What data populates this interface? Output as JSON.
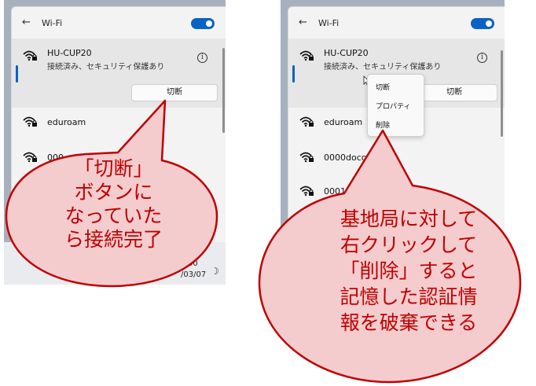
{
  "left": {
    "header_title": "Wi-Fi",
    "active_network": {
      "name": "HU-CUP20",
      "status": "接続済み、セキュリティ保護あり",
      "info": "i",
      "disconnect_label": "切断"
    },
    "networks": [
      "eduroam",
      "000"
    ],
    "clock_time": "50",
    "clock_date": "/03/07"
  },
  "right": {
    "header_title": "Wi-Fi",
    "active_network": {
      "name": "HU-CUP20",
      "status": "接続済み、セキュリティ保護あり",
      "info": "i",
      "disconnect_label": "切断"
    },
    "networks": [
      "eduroam",
      "0000docomo",
      "0001doc"
    ],
    "context_menu": [
      "切断",
      "プロパティ",
      "削除"
    ]
  },
  "callout_left": [
    "「切断」",
    "ボタンに",
    "なっていた",
    "ら接続完了"
  ],
  "callout_right": [
    "基地局に対して",
    "右クリックして",
    "「削除」すると",
    "記憶した認証情",
    "報を破棄できる"
  ],
  "colors": {
    "accent": "#0a62c4",
    "callout_border": "#c00000",
    "callout_fill": "#f4ccce",
    "callout_text": "#c00000"
  },
  "icons": {
    "back": "back-arrow-icon",
    "wifi": "wifi-secured-icon",
    "info": "info-icon",
    "toggle": "toggle-switch",
    "night": "moon-icon",
    "cursor": "mouse-cursor-icon"
  }
}
